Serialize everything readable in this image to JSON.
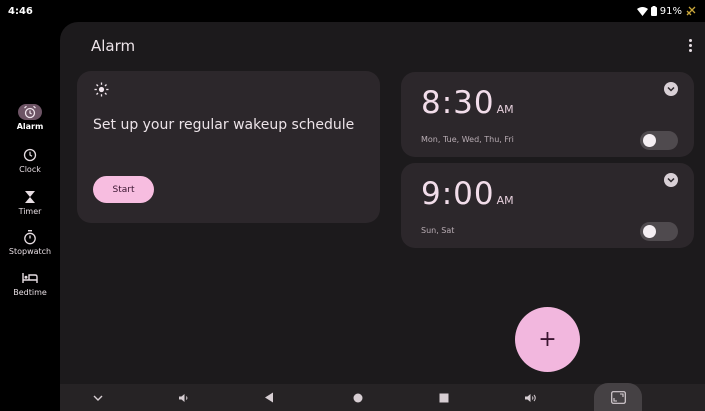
{
  "status": {
    "time": "4:46",
    "battery": "91%"
  },
  "rail": {
    "items": [
      {
        "label": "Alarm",
        "icon": "alarm-clock-icon",
        "active": true
      },
      {
        "label": "Clock",
        "icon": "clock-icon",
        "active": false
      },
      {
        "label": "Timer",
        "icon": "hourglass-icon",
        "active": false
      },
      {
        "label": "Stopwatch",
        "icon": "stopwatch-icon",
        "active": false
      },
      {
        "label": "Bedtime",
        "icon": "bed-icon",
        "active": false
      }
    ]
  },
  "header": {
    "title": "Alarm"
  },
  "wakeup": {
    "text": "Set up your regular wakeup schedule",
    "start_label": "Start"
  },
  "alarms": [
    {
      "time": "8:30",
      "ampm": "AM",
      "days": "Mon, Tue, Wed, Thu, Fri",
      "enabled": false
    },
    {
      "time": "9:00",
      "ampm": "AM",
      "days": "Sun, Sat",
      "enabled": false
    }
  ],
  "fab": {
    "label": "+"
  },
  "colors": {
    "accent": "#f2b7de",
    "card": "#2c272b",
    "panel": "#1c1a1c"
  }
}
